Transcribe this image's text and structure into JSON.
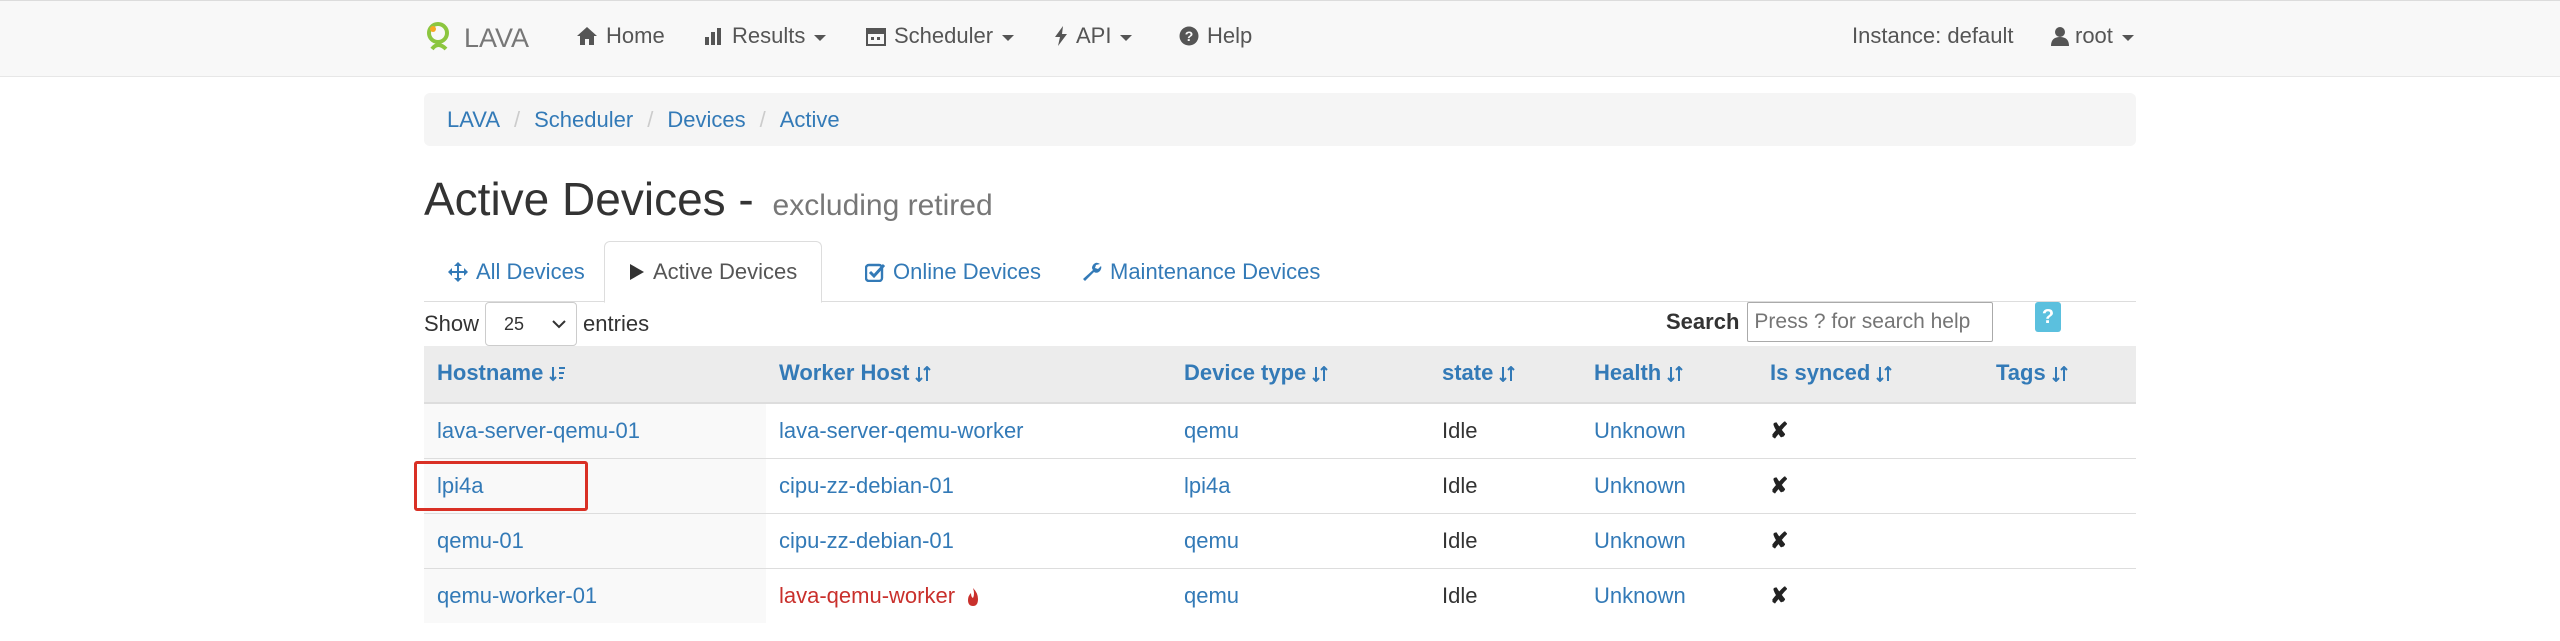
{
  "navbar": {
    "brand": "LAVA",
    "items": [
      {
        "label": "Home",
        "icon": "home-icon"
      },
      {
        "label": "Results",
        "icon": "bar-chart-icon"
      },
      {
        "label": "Scheduler",
        "icon": "calendar-icon"
      },
      {
        "label": "API",
        "icon": "flash-icon"
      },
      {
        "label": "Help",
        "icon": "question-circle-icon"
      }
    ],
    "instance": "Instance: default",
    "user": "root"
  },
  "breadcrumb": [
    "LAVA",
    "Scheduler",
    "Devices",
    "Active"
  ],
  "title": {
    "main": "Active Devices -",
    "sub": "excluding retired"
  },
  "tabs": [
    {
      "label": "All Devices",
      "icon": "move-icon"
    },
    {
      "label": "Active Devices",
      "icon": "play-icon"
    },
    {
      "label": "Online Devices",
      "icon": "check-square-icon"
    },
    {
      "label": "Maintenance Devices",
      "icon": "wrench-icon"
    }
  ],
  "controls": {
    "show_label": "Show",
    "page_size": "25",
    "entries_label": "entries",
    "search_label": "Search",
    "search_placeholder": "Press ? for search help",
    "help_button": "?"
  },
  "table": {
    "columns": [
      "Hostname",
      "Worker Host",
      "Device type",
      "state",
      "Health",
      "Is synced",
      "Tags"
    ],
    "rows": [
      {
        "hostname": "lava-server-qemu-01",
        "worker": "lava-server-qemu-worker",
        "device_type": "qemu",
        "state": "Idle",
        "health": "Unknown",
        "synced": "✘",
        "tags": ""
      },
      {
        "hostname": "lpi4a",
        "worker": "cipu-zz-debian-01",
        "device_type": "lpi4a",
        "state": "Idle",
        "health": "Unknown",
        "synced": "✘",
        "tags": ""
      },
      {
        "hostname": "qemu-01",
        "worker": "cipu-zz-debian-01",
        "device_type": "qemu",
        "state": "Idle",
        "health": "Unknown",
        "synced": "✘",
        "tags": ""
      },
      {
        "hostname": "qemu-worker-01",
        "worker": "lava-qemu-worker",
        "device_type": "qemu",
        "state": "Idle",
        "health": "Unknown",
        "synced": "✘",
        "tags": ""
      }
    ]
  },
  "colors": {
    "link": "#337ab7",
    "worker_offline": "#c9302c",
    "highlight": "#d93025",
    "help_button": "#5bc0de"
  }
}
